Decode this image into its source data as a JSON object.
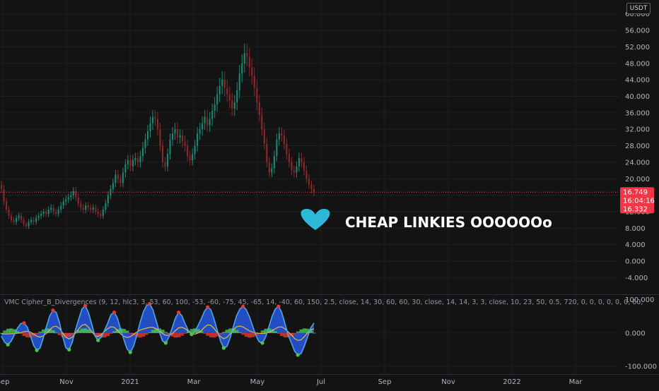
{
  "chart_data": {
    "type": "line",
    "title": "",
    "currency": "USDT",
    "y_axis": {
      "ticks": [
        -4,
        0,
        4,
        8,
        12,
        16,
        20,
        24,
        28,
        32,
        36,
        40,
        44,
        48,
        52,
        56,
        60
      ],
      "tick_labels": [
        "-4.000",
        "0.000",
        "4.000",
        "8.000",
        "12.000",
        "16.000",
        "20.000",
        "24.000",
        "28.000",
        "32.000",
        "36.000",
        "40.000",
        "44.000",
        "48.000",
        "52.000",
        "56.000",
        "60.000"
      ],
      "ylim": [
        -6.5,
        62
      ]
    },
    "x_axis": {
      "tick_labels": [
        "Sep",
        "Nov",
        "2021",
        "Mar",
        "May",
        "Jul",
        "Sep",
        "Nov",
        "2022",
        "Mar"
      ]
    },
    "series": [
      {
        "values": [
          17.5,
          14.5,
          12.5,
          11.0,
          10.0,
          9.5,
          10.5,
          11.0,
          10.0,
          9.0,
          8.5,
          9.5,
          10.0,
          9.5,
          10.5,
          11.0,
          11.5,
          12.0,
          11.5,
          12.5,
          13.0,
          12.0,
          11.5,
          12.5,
          13.5,
          14.5,
          15.0,
          15.5,
          16.0,
          17.0,
          15.5,
          14.0,
          13.0,
          12.5,
          13.5,
          13.0,
          12.5,
          13.0,
          12.0,
          11.5,
          11.0,
          12.5,
          14.0,
          16.0,
          17.5,
          19.0,
          21.0,
          20.0,
          19.0,
          21.5,
          23.5,
          24.5,
          23.0,
          24.5,
          25.0,
          24.0,
          25.5,
          27.5,
          29.5,
          31.5,
          33.5,
          35.0,
          34.5,
          32.0,
          28.0,
          24.0,
          23.0,
          26.0,
          29.5,
          31.0,
          32.0,
          30.0,
          30.5,
          29.0,
          28.0,
          25.5,
          24.5,
          26.0,
          28.0,
          31.0,
          32.0,
          33.5,
          35.0,
          33.0,
          34.5,
          36.5,
          38.0,
          40.5,
          42.5,
          44.0,
          42.0,
          40.5,
          39.0,
          37.0,
          38.5,
          41.5,
          45.5,
          48.0,
          50.5,
          49.5,
          47.0,
          45.0,
          42.0,
          38.5,
          35.5,
          32.0,
          28.5,
          24.0,
          21.5,
          22.5,
          25.5,
          29.5,
          31.0,
          30.5,
          28.5,
          26.0,
          24.0,
          22.0,
          21.5,
          23.0,
          25.0,
          24.0,
          22.0,
          20.0,
          18.5,
          17.5,
          16.7
        ]
      }
    ],
    "price_tags": [
      {
        "label": "16.749",
        "value": 16.749
      },
      {
        "label": "16:04:16",
        "value": 15.2
      },
      {
        "label": "16.332",
        "value": 13.6
      }
    ],
    "annotation": {
      "text": "CHEAP LINKIES OOOOOOo",
      "icon": "heart-icon",
      "icon_color": "#2bb8d9"
    },
    "indicator": {
      "label": "VMC Cipher_B_Divergences (9, 12, hlc3, 3, 53, 60, 100, -53, -60, -75, 45, -65, 14, -40, 60, 150, 2.5, close, 14, 30, 60, 60, 30, close, 14, 14, 3, 3, close, 10, 23, 50, 0.5, 720, 0, 0, 0, 0, 0, 0, 60,",
      "y_ticks": [
        100,
        0,
        -100
      ],
      "y_tick_labels": [
        "100.000",
        "0.000",
        "-100.000"
      ],
      "ylim": [
        -115,
        110
      ],
      "wt1": [
        -10,
        -28,
        -35,
        -25,
        -6,
        15,
        28,
        30,
        18,
        -8,
        -38,
        -52,
        -45,
        -15,
        20,
        52,
        68,
        62,
        32,
        -10,
        -45,
        -50,
        -28,
        10,
        42,
        72,
        82,
        62,
        28,
        -8,
        -22,
        -12,
        8,
        30,
        55,
        62,
        45,
        12,
        -20,
        -48,
        -58,
        -40,
        -8,
        30,
        62,
        82,
        88,
        70,
        38,
        4,
        -24,
        -30,
        -12,
        15,
        45,
        62,
        52,
        28,
        8,
        -4,
        5,
        22,
        42,
        65,
        78,
        70,
        42,
        8,
        -24,
        -45,
        -40,
        -15,
        20,
        52,
        72,
        80,
        70,
        48,
        20,
        -8,
        -26,
        -30,
        -12,
        18,
        50,
        72,
        80,
        62,
        28,
        -6,
        -30,
        -55,
        -66,
        -62,
        -40,
        -12,
        15,
        30
      ]
    },
    "colors": {
      "background": "#131313",
      "candle_up": "#1a8a74",
      "candle_down": "#8a2a2a",
      "last_price": "#f23645",
      "wave_line": "#4da6e8",
      "wave_fill": "#2962ff",
      "money_flow_pos": "#49c94a",
      "money_flow_neg": "#e53935",
      "vwap": "#e8b93a"
    }
  }
}
